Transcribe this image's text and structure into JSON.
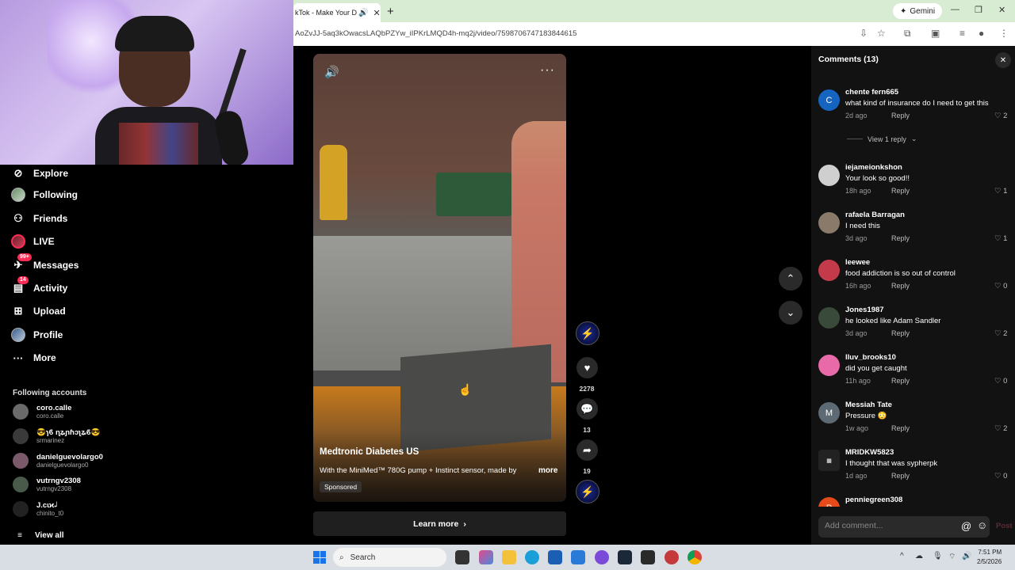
{
  "browser": {
    "tab_title": "kTok - Make Your Da",
    "tab_sound_icon": "speaker-icon",
    "gemini_label": "Gemini",
    "url": "AoZvJJ-5aq3kOwacsLAQbPZYw_iIPKrLMQD4h-mq2j/video/7598706747183844615"
  },
  "nav": {
    "items": [
      {
        "label": "Explore",
        "icon": "compass-icon"
      },
      {
        "label": "Following",
        "icon": "avatar"
      },
      {
        "label": "Friends",
        "icon": "friends-icon"
      },
      {
        "label": "LIVE",
        "icon": "live-avatar"
      },
      {
        "label": "Messages",
        "icon": "messages-icon",
        "badge": "99+"
      },
      {
        "label": "Activity",
        "icon": "activity-icon",
        "badge": "14"
      },
      {
        "label": "Upload",
        "icon": "upload-icon"
      },
      {
        "label": "Profile",
        "icon": "profile-avatar"
      },
      {
        "label": "More",
        "icon": "more-icon"
      }
    ],
    "following_title": "Following accounts",
    "accounts": [
      {
        "name": "coro.calle",
        "handle": "coro.calle"
      },
      {
        "name": "😎ɿϐ ɳʑɲɦɔʅʑϐ😎",
        "handle": "srmarinez"
      },
      {
        "name": "danielguevolargo0",
        "handle": "danielguevolargo0"
      },
      {
        "name": "vutrngv2308",
        "handle": "vutrngv2308"
      },
      {
        "name": "J.cɩϰ𝆺𝅥",
        "handle": "chinito_t0"
      }
    ],
    "view_all": "View all"
  },
  "video": {
    "author": "Medtronic Diabetes US",
    "description": "With the MiniMed™ 780G pump + Instinct sensor, made by",
    "more_label": "more",
    "sponsored": "Sponsored",
    "learn_more": "Learn more",
    "likes": "2278",
    "comments": "13",
    "shares": "19"
  },
  "comments": {
    "title": "Comments (13)",
    "view_replies": "View 1 reply",
    "input_placeholder": "Add comment...",
    "post_label": "Post",
    "reply_label": "Reply",
    "items": [
      {
        "user": "chente fern665",
        "text": "what kind of insurance do I need to get this",
        "time": "2d ago",
        "likes": "2",
        "avatar_letter": "C",
        "avatar_color": "#1565c0"
      },
      {
        "user": "iejameionkshon",
        "text": "Your look so good!!",
        "time": "18h ago",
        "likes": "1",
        "avatar_letter": "",
        "avatar_color": "#cfcfcf"
      },
      {
        "user": "rafaela Barragan",
        "text": "I need this",
        "time": "3d ago",
        "likes": "1",
        "avatar_letter": "",
        "avatar_color": "#8a7a6a"
      },
      {
        "user": "leewee",
        "text": "food addiction is so out of control",
        "time": "16h ago",
        "likes": "0",
        "avatar_letter": "",
        "avatar_color": "#c43a4a"
      },
      {
        "user": "Jones1987",
        "text": "he looked like Adam Sandler",
        "time": "3d ago",
        "likes": "2",
        "avatar_letter": "",
        "avatar_color": "#3a4a3a"
      },
      {
        "user": "lluv_brooks10",
        "text": "did you get caught",
        "time": "11h ago",
        "likes": "0",
        "avatar_letter": "",
        "avatar_color": "#e86aa8"
      },
      {
        "user": "Messiah Tate",
        "text": "Pressure 😳",
        "time": "1w ago",
        "likes": "2",
        "avatar_letter": "M",
        "avatar_color": "#5d6a73"
      },
      {
        "user": "MRIDKW5823",
        "text": "I thought that was sypherpk",
        "time": "1d ago",
        "likes": "0",
        "avatar_letter": "",
        "avatar_color": "#222222"
      },
      {
        "user": "penniegreen308",
        "text": "",
        "time": "",
        "likes": "",
        "avatar_letter": "P",
        "avatar_color": "#e64a19"
      }
    ]
  },
  "taskbar": {
    "search_label": "Search",
    "time": "7:51 PM",
    "date": "2/5/2026"
  }
}
